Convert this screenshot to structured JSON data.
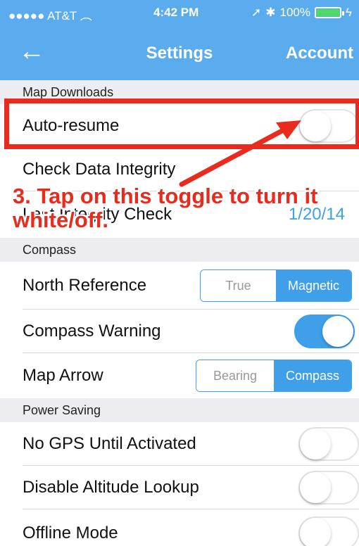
{
  "status_bar": {
    "carrier": "●●●●● AT&T",
    "time": "4:42 PM",
    "battery": "100%"
  },
  "nav": {
    "back_icon": "←",
    "title": "Settings",
    "account_label": "Account"
  },
  "sections": {
    "map_downloads": {
      "header": "Map Downloads",
      "auto_resume": {
        "label": "Auto-resume",
        "on": false
      },
      "check_integrity": {
        "label": "Check Data Integrity"
      },
      "last_integrity_check": {
        "label": "Last Integrity Check",
        "value": "1/20/14"
      }
    },
    "compass": {
      "header": "Compass",
      "north_reference": {
        "label": "North Reference",
        "options": [
          "True",
          "Magnetic"
        ],
        "selected": "Magnetic"
      },
      "compass_warning": {
        "label": "Compass Warning",
        "on": true
      },
      "map_arrow": {
        "label": "Map Arrow",
        "options": [
          "Bearing",
          "Compass"
        ],
        "selected": "Compass"
      }
    },
    "power_saving": {
      "header": "Power Saving",
      "no_gps": {
        "label": "No GPS Until Activated",
        "on": false
      },
      "disable_altitude": {
        "label": "Disable Altitude Lookup",
        "on": false
      },
      "offline_mode": {
        "label": "Offline Mode",
        "on": false
      }
    }
  },
  "annotation": {
    "text": "3. Tap on this toggle to turn it white/off.",
    "color": "#ea2a1c"
  },
  "colors": {
    "accent": "#3f9fe8",
    "nav_bar": "#5aacef",
    "section_bg": "#ececf1"
  }
}
